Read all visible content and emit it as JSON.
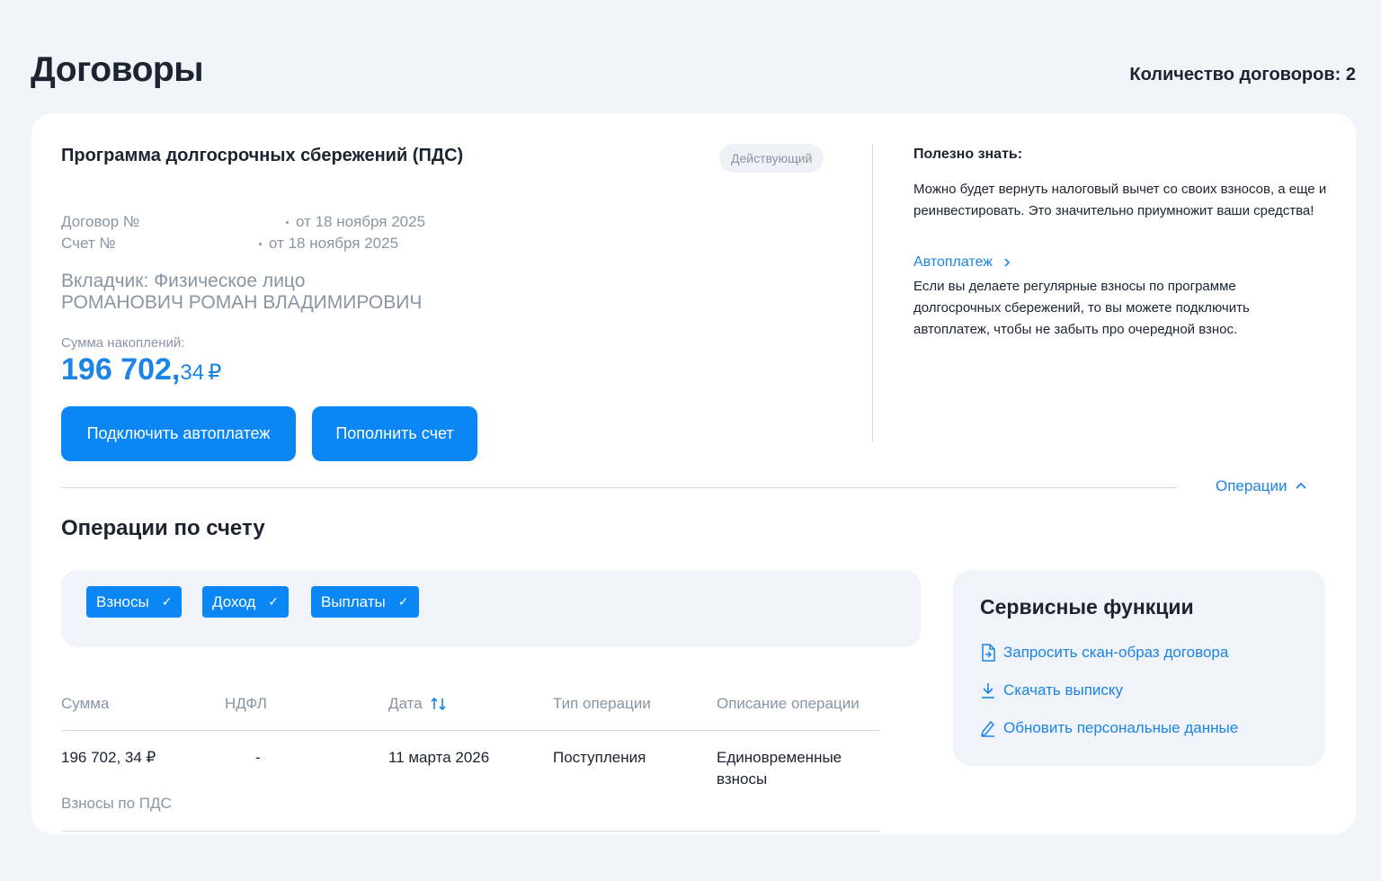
{
  "page": {
    "title": "Договоры",
    "contracts_count": "Количество договоров: 2"
  },
  "contract": {
    "program_title": "Программа долгосрочных сбережений (ПДС)",
    "status": "Действующий",
    "contract_label": "Договор №",
    "contract_date": "от 18 ноября 2025",
    "account_label": "Счет №",
    "account_date": "от 18 ноября 2025",
    "depositor_line1": "Вкладчик: Физическое лицо",
    "depositor_line2": "РОМАНОВИЧ РОМАН ВЛАДИМИРОВИЧ",
    "sum_label": "Сумма накоплений:",
    "sum_int": "196 702,",
    "sum_frac": "34",
    "currency": "₽",
    "btn_autopay": "Подключить автоплатеж",
    "btn_topup": "Пополнить счет"
  },
  "tips": {
    "title": "Полезно знать:",
    "text": "Можно будет вернуть налоговый вычет со своих взносов, а еще и реинвестировать. Это значительно приумножит ваши средства!",
    "autopay_link": "Автоплатеж",
    "autopay_text": "Если вы делаете регулярные взносы по программе долгосрочных сбережений, то вы можете подключить автоплатеж, чтобы не забыть про очередной взнос."
  },
  "operations": {
    "toggle_label": "Операции",
    "title": "Операции по счету",
    "filters": [
      "Взносы",
      "Доход",
      "Выплаты"
    ],
    "columns": [
      "Сумма",
      "НДФЛ",
      "Дата",
      "Тип операции",
      "Описание операции"
    ],
    "rows": [
      {
        "amount": "196 702, 34 ₽",
        "ndfl": "-",
        "date": "11 марта 2026",
        "type": "Поступления",
        "description": "Единовременные взносы",
        "subtitle": "Взносы по ПДС"
      }
    ]
  },
  "services": {
    "title": "Сервисные функции",
    "items": [
      "Запросить скан-образ договора",
      "Скачать выписку",
      "Обновить персональные данные"
    ]
  },
  "colors": {
    "accent": "#0a86f5",
    "link": "#1b84e7",
    "background": "#f1f4f9",
    "muted": "#8a95a3"
  }
}
